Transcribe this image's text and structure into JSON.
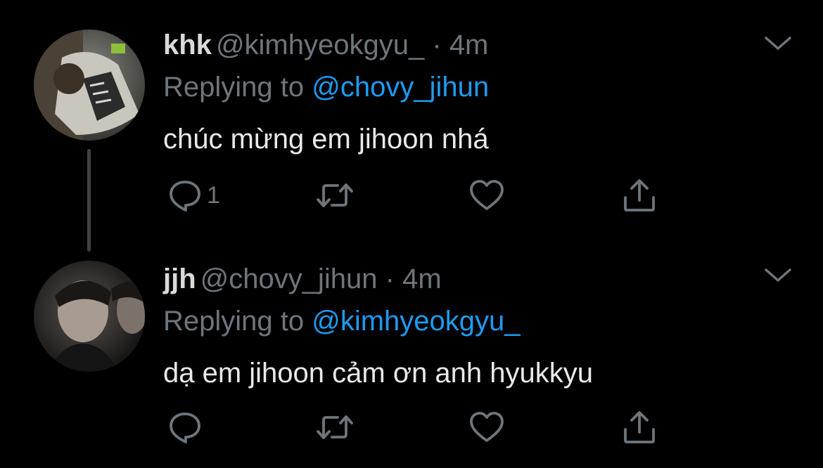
{
  "colors": {
    "background": "#000000",
    "text_primary": "#e7e9ea",
    "text_secondary": "#6e767d",
    "link": "#1d9bf0"
  },
  "tweets": [
    {
      "display_name": "khk",
      "handle": "@kimhyeokgyu_",
      "dot": "·",
      "time": "4m",
      "reply_prefix": "Replying to ",
      "reply_to": "@chovy_jihun",
      "text": "chúc mừng em jihoon nhá",
      "reply_count": "1",
      "icons": [
        "reply-icon",
        "retweet-icon",
        "like-icon",
        "share-icon",
        "chevron-down-icon"
      ]
    },
    {
      "display_name": "jjh",
      "handle": "@chovy_jihun",
      "dot": "·",
      "time": "4m",
      "reply_prefix": "Replying to ",
      "reply_to": "@kimhyeokgyu_",
      "text": "dạ em jihoon cảm ơn anh hyukkyu",
      "reply_count": "",
      "icons": [
        "reply-icon",
        "retweet-icon",
        "like-icon",
        "share-icon",
        "chevron-down-icon"
      ]
    }
  ]
}
